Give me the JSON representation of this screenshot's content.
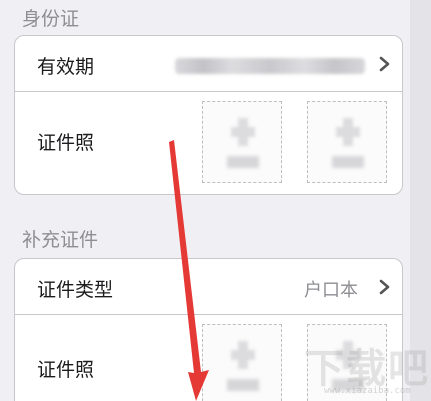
{
  "sections": [
    {
      "title": "身份证",
      "rows": [
        {
          "label": "有效期",
          "value_obscured": true
        },
        {
          "label": "证件照"
        }
      ]
    },
    {
      "title": "补充证件",
      "rows": [
        {
          "label": "证件类型",
          "value": "户口本"
        },
        {
          "label": "证件照"
        }
      ]
    }
  ],
  "icons": {
    "chevron": "chevron-right-icon",
    "upload": "add-photo-icon"
  },
  "annotation": {
    "arrow_color": "#e53935"
  },
  "watermark": {
    "text": "下载吧",
    "url": "www.xiazaiba.com"
  },
  "colors": {
    "background": "#efeff4",
    "card": "#ffffff",
    "label": "#1c1c1e",
    "secondary": "#8e8e93"
  }
}
